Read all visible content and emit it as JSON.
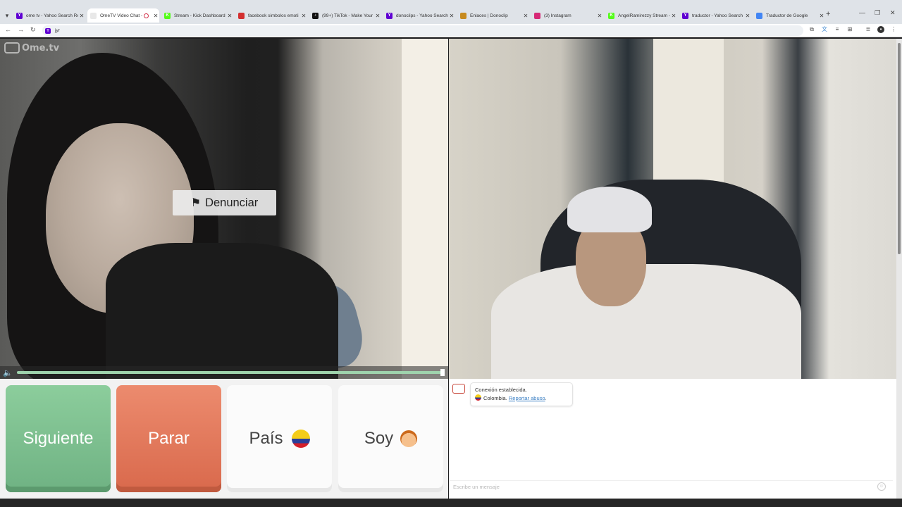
{
  "browser": {
    "tabs": [
      {
        "title": "ome tv - Yahoo Search Re",
        "favicon_color": "#6001d2",
        "favicon_glyph": "Y",
        "active": false
      },
      {
        "title": "OmeTV Video Chat - ",
        "favicon_color": "#e8e8e8",
        "favicon_glyph": "",
        "active": true,
        "recording": true
      },
      {
        "title": "Stream - Kick Dashboard",
        "favicon_color": "#53fc18",
        "favicon_glyph": "K",
        "active": false
      },
      {
        "title": "facebook simbolos emoti",
        "favicon_color": "#d32f2f",
        "favicon_glyph": "",
        "active": false
      },
      {
        "title": "(99+) TikTok - Make Your D",
        "favicon_color": "#111111",
        "favicon_glyph": "♪",
        "active": false
      },
      {
        "title": "donoclips - Yahoo Search",
        "favicon_color": "#6001d2",
        "favicon_glyph": "Y",
        "active": false
      },
      {
        "title": "Enlaces | Donoclip",
        "favicon_color": "#c78a1e",
        "favicon_glyph": "",
        "active": false
      },
      {
        "title": "(3) Instagram",
        "favicon_color": "#d62976",
        "favicon_glyph": "",
        "active": false
      },
      {
        "title": "AngelRamirezzy Stream -",
        "favicon_color": "#53fc18",
        "favicon_glyph": "K",
        "active": false
      },
      {
        "title": "traductor - Yahoo Search",
        "favicon_color": "#6001d2",
        "favicon_glyph": "Y",
        "active": false
      },
      {
        "title": "Traductor de Google",
        "favicon_color": "#4285f4",
        "favicon_glyph": "",
        "active": false
      }
    ],
    "url": "jyr"
  },
  "video": {
    "logo_text": "Ome.tv",
    "report_label": "Denunciar"
  },
  "buttons": {
    "next": "Siguiente",
    "stop": "Parar",
    "country": "País",
    "gender": "Soy"
  },
  "chat": {
    "system_message": "Conexión establecida.",
    "country": "Colombia.",
    "report_link": "Reportar abuso",
    "input_placeholder": "Escribe un mensaje"
  },
  "colors": {
    "next": "#7cc08f",
    "stop": "#e47a5c",
    "progress": "#9fd3ad",
    "link": "#3a7fc4"
  }
}
